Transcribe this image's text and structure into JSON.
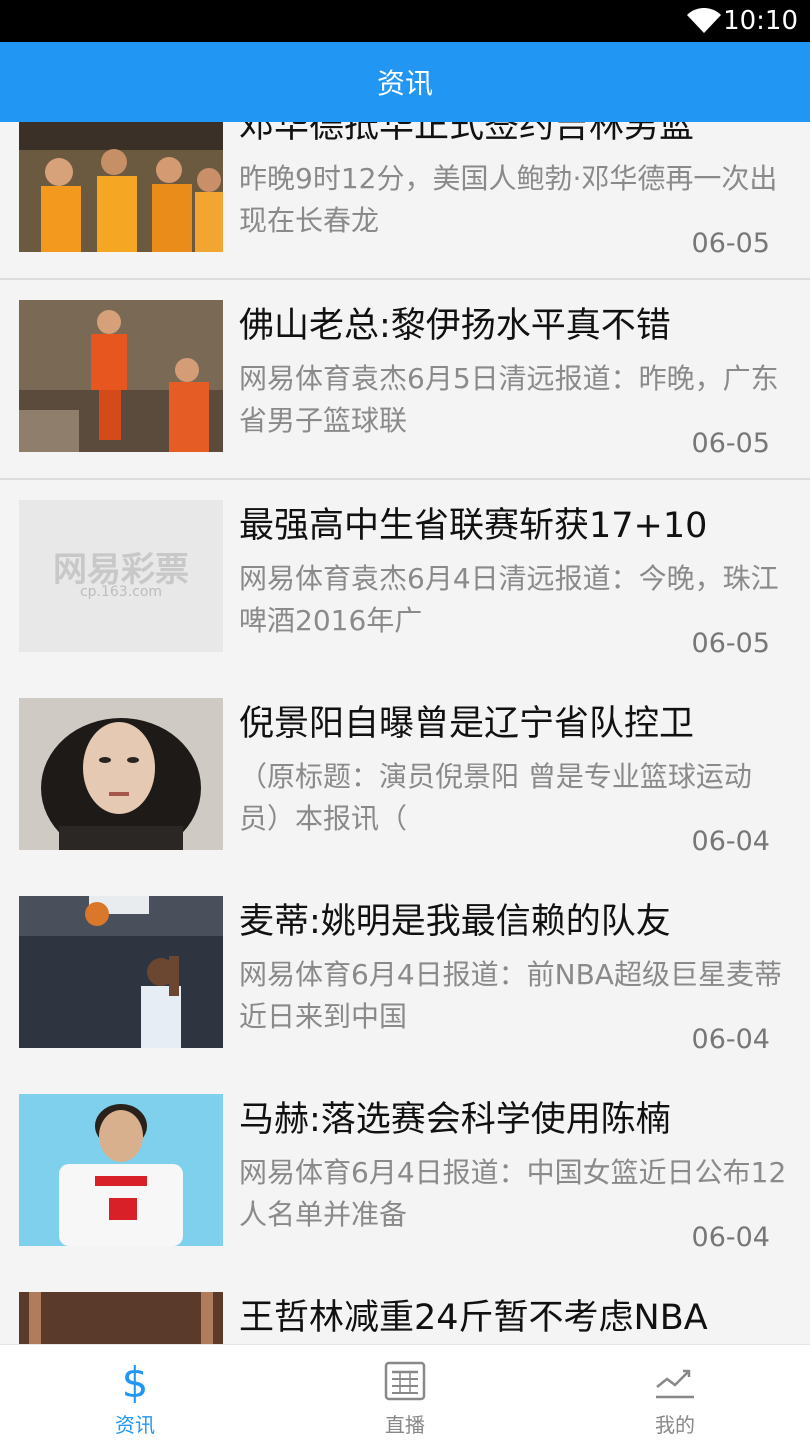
{
  "status_bar": {
    "time": "10:10"
  },
  "header": {
    "title": "资讯"
  },
  "articles": [
    {
      "title": "邓华德抵华正式签约吉林男篮",
      "summary": "昨晚9时12分，美国人鲍勃·邓华德再一次出现在长春龙",
      "date": "06-05"
    },
    {
      "title": "佛山老总:黎伊扬水平真不错",
      "summary": "网易体育袁杰6月5日清远报道：昨晚，广东省男子篮球联",
      "date": "06-05"
    },
    {
      "title": "最强高中生省联赛斩获17+10",
      "summary": "网易体育袁杰6月4日清远报道：今晚，珠江啤酒2016年广",
      "date": "06-05",
      "thumb_logo": "网易彩票",
      "thumb_logo_sub": "cp.163.com"
    },
    {
      "title": "倪景阳自曝曾是辽宁省队控卫",
      "summary": "（原标题：演员倪景阳 曾是专业篮球运动员）本报讯（",
      "date": "06-04"
    },
    {
      "title": "麦蒂:姚明是我最信赖的队友",
      "summary": "网易体育6月4日报道：前NBA超级巨星麦蒂近日来到中国",
      "date": "06-04"
    },
    {
      "title": "马赫:落选赛会科学使用陈楠",
      "summary": "网易体育6月4日报道：中国女篮近日公布12人名单并准备",
      "date": "06-04"
    },
    {
      "title": "王哲林减重24斤暂不考虑NBA",
      "summary": "",
      "date": ""
    }
  ],
  "tabs": [
    {
      "label": "资讯",
      "icon": "dollar-icon"
    },
    {
      "label": "直播",
      "icon": "newspaper-icon"
    },
    {
      "label": "我的",
      "icon": "chart-icon"
    }
  ],
  "colors": {
    "accent": "#2196f3",
    "background": "#f4f4f4"
  }
}
